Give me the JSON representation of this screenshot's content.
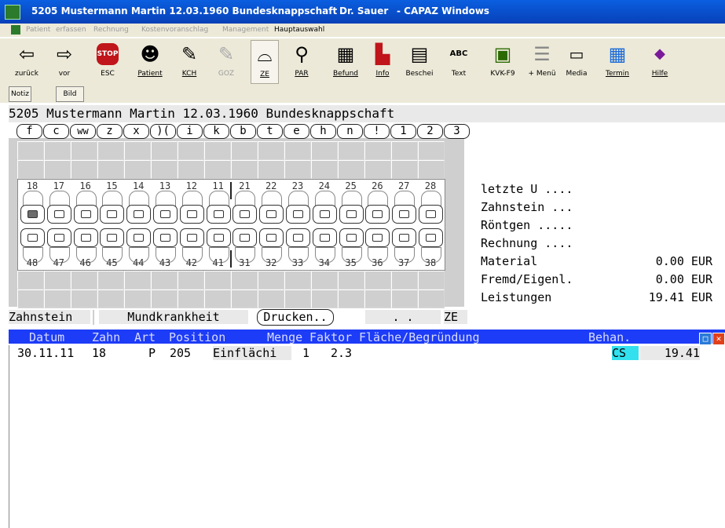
{
  "window": {
    "title_main": "5205 Mustermann Martin 12.03.1960 Bundesknappschaft",
    "title_doctor": "Dr. Sauer",
    "title_app": "- CAPAZ Windows"
  },
  "menu": [
    {
      "label": "Patient"
    },
    {
      "label": "erfassen"
    },
    {
      "label": "Rechnung"
    },
    {
      "label": "Kostenvoranschlag"
    },
    {
      "label": "Management"
    },
    {
      "label": "Hauptauswahl"
    }
  ],
  "toolbar": [
    {
      "label": "zurück",
      "icon": "arrow-left-icon",
      "glyph": "⇦"
    },
    {
      "label": "vor",
      "icon": "arrow-right-icon",
      "glyph": "⇨"
    },
    {
      "label": "ESC",
      "icon": "stop-sign-icon",
      "glyph": "STOP"
    },
    {
      "label": "Patient",
      "icon": "patient-face-icon",
      "glyph": "☻"
    },
    {
      "label": "KCH",
      "icon": "pencil-block-icon",
      "glyph": "✎"
    },
    {
      "label": "GOZ",
      "icon": "pencil-block-gray-icon",
      "glyph": "✎"
    },
    {
      "label": "ZE",
      "icon": "dental-prosthesis-icon",
      "glyph": "⌓"
    },
    {
      "label": "PAR",
      "icon": "dental-hook-icon",
      "glyph": "⚲"
    },
    {
      "label": "Befund",
      "icon": "dental-chart-icon",
      "glyph": "▦"
    },
    {
      "label": "Info",
      "icon": "info-book-icon",
      "glyph": "▙"
    },
    {
      "label": "Beschei",
      "icon": "certificate-icon",
      "glyph": "▤"
    },
    {
      "label": "Text",
      "icon": "spellcheck-icon",
      "glyph": "ABC"
    },
    {
      "label": "KVK-F9",
      "icon": "chip-card-icon",
      "glyph": "▣"
    },
    {
      "label": "+ Menü",
      "icon": "menu-list-icon",
      "glyph": "☰"
    },
    {
      "label": "Media",
      "icon": "media-monitor-icon",
      "glyph": "▭"
    },
    {
      "label": "Termin",
      "icon": "calendar-icon",
      "glyph": "▦"
    },
    {
      "label": "Hilfe",
      "icon": "help-book-icon",
      "glyph": "◆"
    }
  ],
  "subbuttons": {
    "notiz": "Notiz",
    "bild": "Bild"
  },
  "patient_line": "5205 Mustermann Martin 12.03.1960  Bundesknappschaft",
  "letter_buttons": [
    "f",
    "c",
    "ww",
    "z",
    "x",
    ")(",
    "i",
    "k",
    "b",
    "t",
    "e",
    "h",
    "n",
    "!",
    "1",
    "2",
    "3"
  ],
  "teeth": {
    "upper": [
      "18",
      "17",
      "16",
      "15",
      "14",
      "13",
      "12",
      "11",
      "21",
      "22",
      "23",
      "24",
      "25",
      "26",
      "27",
      "28"
    ],
    "lower": [
      "48",
      "47",
      "46",
      "45",
      "44",
      "43",
      "42",
      "41",
      "31",
      "32",
      "33",
      "34",
      "35",
      "36",
      "37",
      "38"
    ],
    "marked_tooth": "18"
  },
  "info": {
    "letzte_u": "letzte U ....",
    "zahnstein": "Zahnstein ...",
    "roentgen": "Röntgen .....",
    "rechnung": "Rechnung ....",
    "material": "Material",
    "material_amount": "0.00 EUR",
    "fremd": "Fremd/Eigenl.",
    "fremd_amount": "0.00 EUR",
    "leistungen": "Leistungen",
    "leistungen_amount": "19.41 EUR"
  },
  "status": {
    "zahnstein": "Zahnstein",
    "mundkrankheit": "Mundkrankheit",
    "drucken": "Drucken..",
    "dots": ". .",
    "ze": "ZE"
  },
  "table": {
    "headers": [
      "Datum",
      "Zahn",
      "Art",
      "Position",
      "Menge",
      "Faktor",
      "Fläche/Begründung",
      "Behan."
    ],
    "rows": [
      {
        "datum": "30.11.11",
        "zahn": "18",
        "art": "P",
        "position": "205",
        "desc": "Einflächi",
        "menge": "1",
        "faktor": "2.3",
        "behan": "CS",
        "betrag": "19.41"
      }
    ]
  },
  "colors": {
    "title_blue": "#0a5fe0",
    "table_header": "#1d3cf7",
    "behan_highlight": "#33e0ee"
  }
}
